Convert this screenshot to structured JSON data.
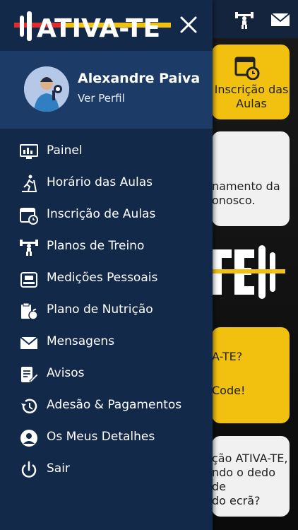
{
  "header": {
    "logo_text": "ATIVA-TE"
  },
  "profile": {
    "name": "Alexandre Paiva",
    "link": "Ver Perfil"
  },
  "menu": [
    {
      "label": "Painel",
      "icon": "dashboard-icon"
    },
    {
      "label": "Horário das Aulas",
      "icon": "treadmill-icon"
    },
    {
      "label": "Inscrição de Aulas",
      "icon": "calendar-clock-icon"
    },
    {
      "label": "Planos de Treino",
      "icon": "weightlifter-icon"
    },
    {
      "label": "Medições Pessoais",
      "icon": "scale-icon"
    },
    {
      "label": "Plano de Nutrição",
      "icon": "nutrition-icon"
    },
    {
      "label": "Mensagens",
      "icon": "mail-icon"
    },
    {
      "label": "Avisos",
      "icon": "notes-icon"
    },
    {
      "label": "Adesão & Pagamentos",
      "icon": "history-icon"
    },
    {
      "label": "Os Meus Detalhes",
      "icon": "user-circle-icon"
    },
    {
      "label": "Sair",
      "icon": "power-icon"
    }
  ],
  "background": {
    "card1": [
      "Inscrição das",
      "Aulas"
    ],
    "card2": [
      "namento da",
      "onosco."
    ],
    "card3": [
      "A-TE?",
      "Code!"
    ],
    "card4": [
      "ção ATIVA-TE,",
      "ndo o dedo de",
      "do ecrã?"
    ]
  },
  "colors": {
    "drawer": "#13294a",
    "profile": "#1c3c67",
    "accent_yellow": "#f2c00e",
    "accent_red": "#e22b2b"
  }
}
